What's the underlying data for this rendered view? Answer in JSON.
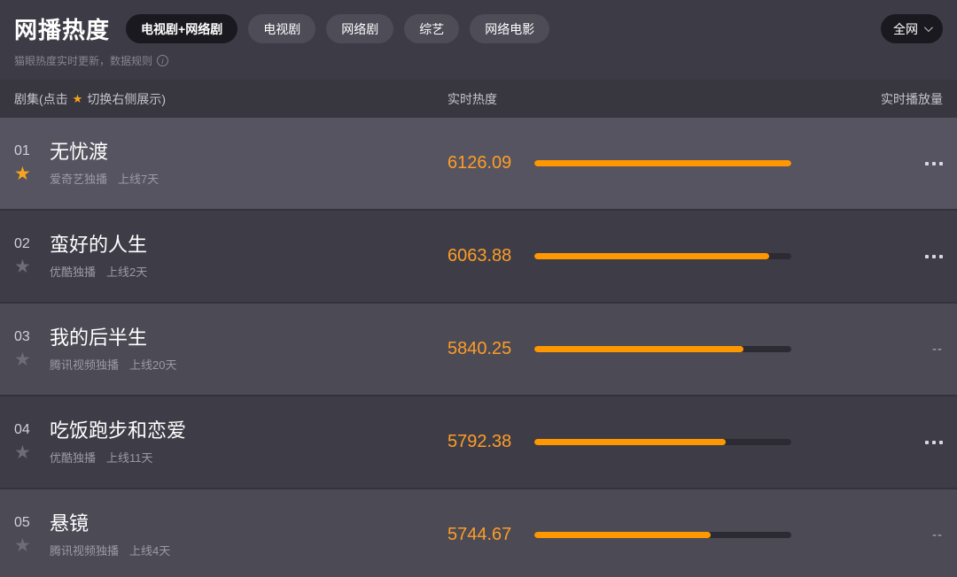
{
  "header": {
    "title": "网播热度",
    "tabs": [
      {
        "label": "电视剧+网络剧",
        "active": true
      },
      {
        "label": "电视剧",
        "active": false
      },
      {
        "label": "网络剧",
        "active": false
      },
      {
        "label": "综艺",
        "active": false
      },
      {
        "label": "网络电影",
        "active": false
      }
    ],
    "network_filter": {
      "label": "全网"
    },
    "subtitle_prefix": "猫眼热度实时更新，",
    "rules_label": "数据规则",
    "info_icon": "info-icon"
  },
  "table": {
    "columns": {
      "series_prefix": "剧集(点击",
      "series_star": "★",
      "series_suffix": "切换右侧展示)",
      "heat": "实时热度",
      "plays": "实时播放量"
    },
    "rows": [
      {
        "rank": "01",
        "starred": true,
        "highlighted": true,
        "title": "无忧渡",
        "platform": "爱奇艺独播",
        "online": "上线7天",
        "heat": "6126.09",
        "bar_percent": 100,
        "plays": "..."
      },
      {
        "rank": "02",
        "starred": false,
        "highlighted": false,
        "title": "蛮好的人生",
        "platform": "优酷独播",
        "online": "上线2天",
        "heat": "6063.88",
        "bar_percent": 91.5,
        "plays": "..."
      },
      {
        "rank": "03",
        "starred": false,
        "highlighted": false,
        "title": "我的后半生",
        "platform": "腾讯视频独播",
        "online": "上线20天",
        "heat": "5840.25",
        "bar_percent": 81.5,
        "plays": "--"
      },
      {
        "rank": "04",
        "starred": false,
        "highlighted": false,
        "title": "吃饭跑步和恋爱",
        "platform": "优酷独播",
        "online": "上线11天",
        "heat": "5792.38",
        "bar_percent": 74.5,
        "plays": "..."
      },
      {
        "rank": "05",
        "starred": false,
        "highlighted": false,
        "title": "悬镜",
        "platform": "腾讯视频独播",
        "online": "上线4天",
        "heat": "5744.67",
        "bar_percent": 68.5,
        "plays": "--"
      }
    ]
  },
  "colors": {
    "accent_orange_bar": "#ff9800",
    "heat_value_text": "#ff9d26",
    "star_active": "#f8a41b",
    "star_inactive": "#6d6c77",
    "bar_track": "#2c2b33",
    "page_background": "#3d3c46",
    "active_pill": "#1a191f"
  }
}
